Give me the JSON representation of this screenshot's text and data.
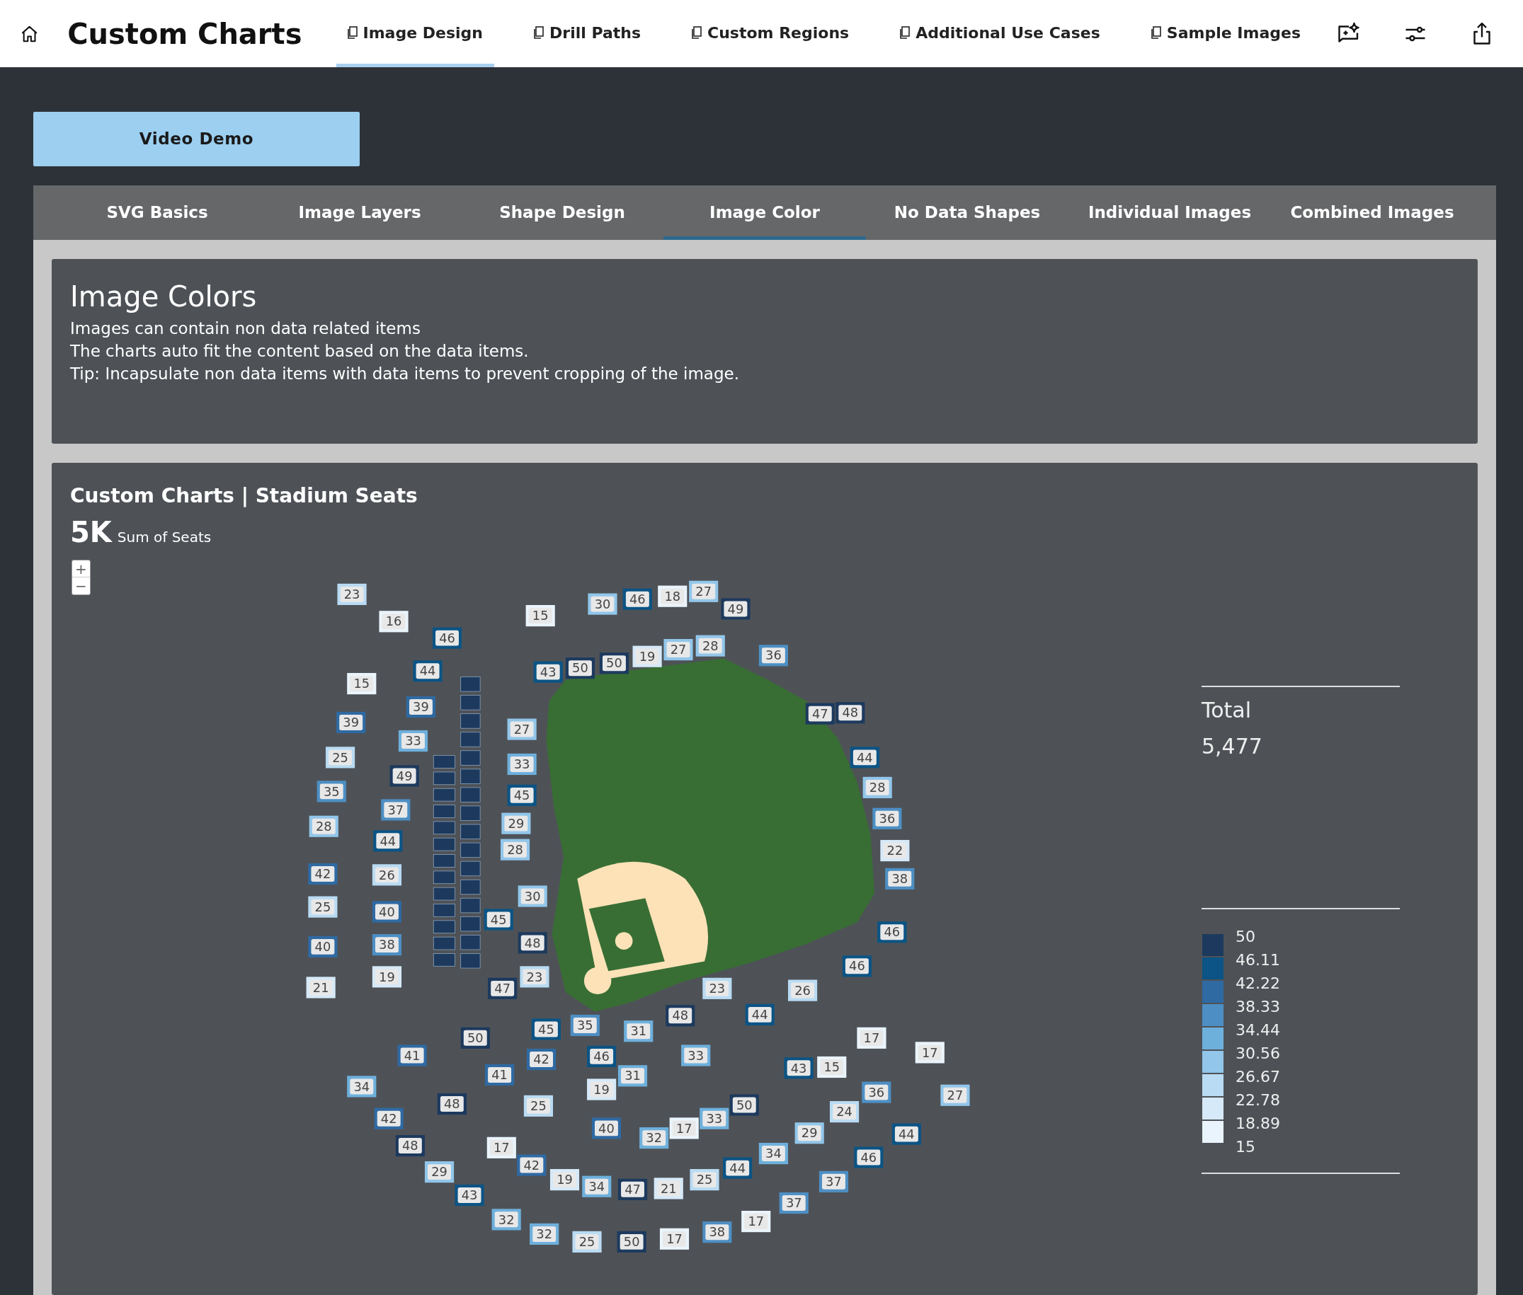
{
  "header": {
    "title": "Custom Charts",
    "nav": [
      {
        "label": "Image Design",
        "selected": true
      },
      {
        "label": "Drill Paths",
        "selected": false
      },
      {
        "label": "Custom Regions",
        "selected": false
      },
      {
        "label": "Additional Use Cases",
        "selected": false
      },
      {
        "label": "Sample Images",
        "selected": false
      }
    ]
  },
  "video_button": "Video Demo",
  "tabs": [
    {
      "label": "SVG Basics",
      "selected": false
    },
    {
      "label": "Image Layers",
      "selected": false
    },
    {
      "label": "Shape Design",
      "selected": false
    },
    {
      "label": "Image Color",
      "selected": true
    },
    {
      "label": "No Data Shapes",
      "selected": false
    },
    {
      "label": "Individual Images",
      "selected": false
    },
    {
      "label": "Combined Images",
      "selected": false
    }
  ],
  "info": {
    "title": "Image Colors",
    "lines": [
      "Images can contain non data related items",
      "The charts auto fit the content based on the data items.",
      "Tip: Incapsulate non data items with data items to prevent cropping of the image."
    ]
  },
  "chart": {
    "title": "Custom Charts | Stadium Seats",
    "kpi": "5K",
    "kpi_label": "Sum of Seats",
    "zoom": {
      "in": "+",
      "out": "−"
    },
    "sections": [
      {
        "label": "23",
        "color": "#b9dbf3"
      },
      {
        "label": "16",
        "color": "#eaf4fc"
      },
      {
        "label": "15",
        "color": "#eaf4fc"
      },
      {
        "label": "30",
        "color": "#92c6ea"
      },
      {
        "label": "46",
        "color": "#0b5485"
      },
      {
        "label": "18",
        "color": "#eaf4fc"
      },
      {
        "label": "27",
        "color": "#92c6ea"
      },
      {
        "label": "49",
        "color": "#1d3a5e"
      },
      {
        "label": "15",
        "color": "#eaf4fc"
      },
      {
        "label": "46",
        "color": "#0b5485"
      },
      {
        "label": "44",
        "color": "#0b5485"
      },
      {
        "label": "43",
        "color": "#0b5485"
      },
      {
        "label": "50",
        "color": "#1d3a5e"
      },
      {
        "label": "50",
        "color": "#1d3a5e"
      },
      {
        "label": "19",
        "color": "#d6e9f8"
      },
      {
        "label": "27",
        "color": "#92c6ea"
      },
      {
        "label": "28",
        "color": "#92c6ea"
      },
      {
        "label": "36",
        "color": "#4d8fc4"
      },
      {
        "label": "39",
        "color": "#2f6aa3"
      },
      {
        "label": "39",
        "color": "#2f6aa3"
      },
      {
        "label": "33",
        "color": "#6eb0dc"
      },
      {
        "label": "27",
        "color": "#92c6ea"
      },
      {
        "label": "47",
        "color": "#1d3a5e"
      },
      {
        "label": "48",
        "color": "#1d3a5e"
      },
      {
        "label": "25",
        "color": "#b9dbf3"
      },
      {
        "label": "35",
        "color": "#4d8fc4"
      },
      {
        "label": "49",
        "color": "#1d3a5e"
      },
      {
        "label": "33",
        "color": "#6eb0dc"
      },
      {
        "label": "45",
        "color": "#0b5485"
      },
      {
        "label": "44",
        "color": "#0b5485"
      },
      {
        "label": "28",
        "color": "#92c6ea"
      },
      {
        "label": "28",
        "color": "#92c6ea"
      },
      {
        "label": "37",
        "color": "#4d8fc4"
      },
      {
        "label": "29",
        "color": "#92c6ea"
      },
      {
        "label": "36",
        "color": "#4d8fc4"
      },
      {
        "label": "44",
        "color": "#0b5485"
      },
      {
        "label": "28",
        "color": "#92c6ea"
      },
      {
        "label": "22",
        "color": "#d6e9f8"
      },
      {
        "label": "42",
        "color": "#2f6aa3"
      },
      {
        "label": "26",
        "color": "#b9dbf3"
      },
      {
        "label": "38",
        "color": "#4d8fc4"
      },
      {
        "label": "25",
        "color": "#b9dbf3"
      },
      {
        "label": "40",
        "color": "#2f6aa3"
      },
      {
        "label": "40",
        "color": "#2f6aa3"
      },
      {
        "label": "38",
        "color": "#4d8fc4"
      },
      {
        "label": "45",
        "color": "#0b5485"
      },
      {
        "label": "30",
        "color": "#92c6ea"
      },
      {
        "label": "48",
        "color": "#1d3a5e"
      },
      {
        "label": "46",
        "color": "#0b5485"
      },
      {
        "label": "21",
        "color": "#d6e9f8"
      },
      {
        "label": "19",
        "color": "#d6e9f8"
      },
      {
        "label": "47",
        "color": "#1d3a5e"
      },
      {
        "label": "23",
        "color": "#b9dbf3"
      },
      {
        "label": "23",
        "color": "#b9dbf3"
      },
      {
        "label": "26",
        "color": "#b9dbf3"
      },
      {
        "label": "46",
        "color": "#0b5485"
      },
      {
        "label": "50",
        "color": "#1d3a5e"
      },
      {
        "label": "45",
        "color": "#0b5485"
      },
      {
        "label": "35",
        "color": "#4d8fc4"
      },
      {
        "label": "31",
        "color": "#6eb0dc"
      },
      {
        "label": "48",
        "color": "#1d3a5e"
      },
      {
        "label": "44",
        "color": "#0b5485"
      },
      {
        "label": "41",
        "color": "#2f6aa3"
      },
      {
        "label": "34",
        "color": "#6eb0dc"
      },
      {
        "label": "42",
        "color": "#2f6aa3"
      },
      {
        "label": "48",
        "color": "#1d3a5e"
      },
      {
        "label": "48",
        "color": "#1d3a5e"
      },
      {
        "label": "29",
        "color": "#92c6ea"
      },
      {
        "label": "43",
        "color": "#0b5485"
      },
      {
        "label": "41",
        "color": "#2f6aa3"
      },
      {
        "label": "42",
        "color": "#2f6aa3"
      },
      {
        "label": "25",
        "color": "#b9dbf3"
      },
      {
        "label": "17",
        "color": "#eaf4fc"
      },
      {
        "label": "42",
        "color": "#2f6aa3"
      },
      {
        "label": "46",
        "color": "#0b5485"
      },
      {
        "label": "19",
        "color": "#d6e9f8"
      },
      {
        "label": "40",
        "color": "#2f6aa3"
      },
      {
        "label": "19",
        "color": "#d6e9f8"
      },
      {
        "label": "34",
        "color": "#6eb0dc"
      },
      {
        "label": "31",
        "color": "#6eb0dc"
      },
      {
        "label": "33",
        "color": "#6eb0dc"
      },
      {
        "label": "32",
        "color": "#6eb0dc"
      },
      {
        "label": "17",
        "color": "#eaf4fc"
      },
      {
        "label": "47",
        "color": "#1d3a5e"
      },
      {
        "label": "21",
        "color": "#d6e9f8"
      },
      {
        "label": "33",
        "color": "#6eb0dc"
      },
      {
        "label": "25",
        "color": "#b9dbf3"
      },
      {
        "label": "50",
        "color": "#1d3a5e"
      },
      {
        "label": "44",
        "color": "#0b5485"
      },
      {
        "label": "43",
        "color": "#0b5485"
      },
      {
        "label": "34",
        "color": "#6eb0dc"
      },
      {
        "label": "29",
        "color": "#92c6ea"
      },
      {
        "label": "37",
        "color": "#4d8fc4"
      },
      {
        "label": "15",
        "color": "#eaf4fc"
      },
      {
        "label": "17",
        "color": "#eaf4fc"
      },
      {
        "label": "24",
        "color": "#b9dbf3"
      },
      {
        "label": "37",
        "color": "#4d8fc4"
      },
      {
        "label": "36",
        "color": "#4d8fc4"
      },
      {
        "label": "46",
        "color": "#0b5485"
      },
      {
        "label": "17",
        "color": "#eaf4fc"
      },
      {
        "label": "44",
        "color": "#0b5485"
      },
      {
        "label": "27",
        "color": "#92c6ea"
      },
      {
        "label": "32",
        "color": "#6eb0dc"
      },
      {
        "label": "32",
        "color": "#6eb0dc"
      },
      {
        "label": "25",
        "color": "#b9dbf3"
      },
      {
        "label": "50",
        "color": "#1d3a5e"
      },
      {
        "label": "17",
        "color": "#eaf4fc"
      },
      {
        "label": "38",
        "color": "#4d8fc4"
      },
      {
        "label": "17",
        "color": "#eaf4fc"
      }
    ],
    "total_label": "Total",
    "total_value": "5,477",
    "legend": {
      "labels": [
        "50",
        "46.11",
        "42.22",
        "38.33",
        "34.44",
        "30.56",
        "26.67",
        "22.78",
        "18.89",
        "15"
      ],
      "bands": [
        {
          "color": "#1d3a5e"
        },
        {
          "color": "#0b5485"
        },
        {
          "color": "#2f6aa3"
        },
        {
          "color": "#4d8fc4"
        },
        {
          "color": "#6eb0dc"
        },
        {
          "color": "#92c6ea"
        },
        {
          "color": "#b9dbf3"
        },
        {
          "color": "#d6e9f8"
        },
        {
          "color": "#eaf4fc"
        }
      ]
    }
  }
}
